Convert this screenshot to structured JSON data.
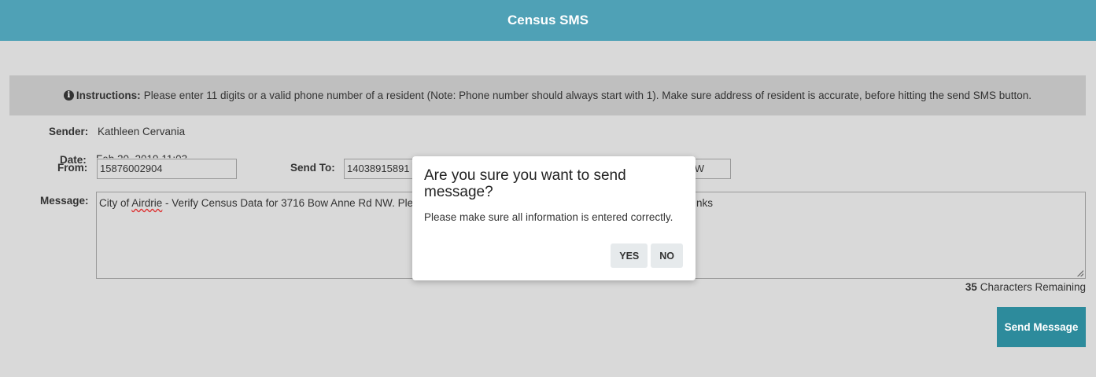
{
  "header": {
    "title": "Census SMS"
  },
  "instructions": {
    "icon": "info-circle-icon",
    "label": "Instructions:",
    "text": "Please enter 11 digits or a valid phone number of a resident (Note: Phone number should always start with 1). Make sure address of resident is accurate, before hitting the send SMS button."
  },
  "form": {
    "sender_label": "Sender:",
    "sender_value": "Kathleen Cervania",
    "date_label": "Date:",
    "date_value": "Feb 20, 2019 11:03",
    "from_label": "From:",
    "from_value": "15876002904",
    "send_to_label": "Send To:",
    "send_to_value": "14038915891",
    "address_value": "W",
    "message_label": "Message:",
    "message_prefix": "City of ",
    "message_squiggle": "Airdrie",
    "message_middle": " - Verify Census Data for 3716 Bow Anne Rd NW. Ple",
    "message_tail": "nks",
    "remaining_count": "35",
    "remaining_text": " Characters Remaining",
    "send_button": "Send Message"
  },
  "modal": {
    "title": "Are you sure you want to send message?",
    "text": "Please make sure all information is entered correctly.",
    "yes": "YES",
    "no": "NO"
  },
  "colors": {
    "header": "#4fa1b6",
    "send_button": "#2d8b9c",
    "background": "#d9d9d9"
  }
}
